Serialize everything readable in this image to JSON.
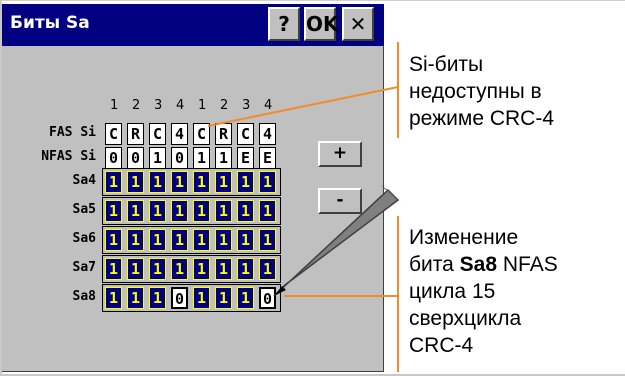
{
  "window": {
    "title": "Биты Sa",
    "help_label": "?",
    "ok_label": "OK",
    "close_label": "✕"
  },
  "column_numbers": [
    "1",
    "2",
    "3",
    "4",
    "1",
    "2",
    "3",
    "4"
  ],
  "rows": [
    {
      "label": "FAS Si",
      "style": "white",
      "values": [
        "C",
        "R",
        "C",
        "4",
        "C",
        "R",
        "C",
        "4"
      ]
    },
    {
      "label": "NFAS Si",
      "style": "white",
      "values": [
        "0",
        "0",
        "1",
        "0",
        "1",
        "1",
        "E",
        "E"
      ]
    },
    {
      "label": "Sa4",
      "style": "blue",
      "values": [
        "1",
        "1",
        "1",
        "1",
        "1",
        "1",
        "1",
        "1"
      ]
    },
    {
      "label": "Sa5",
      "style": "blue",
      "values": [
        "1",
        "1",
        "1",
        "1",
        "1",
        "1",
        "1",
        "1"
      ]
    },
    {
      "label": "Sa6",
      "style": "blue",
      "values": [
        "1",
        "1",
        "1",
        "1",
        "1",
        "1",
        "1",
        "1"
      ]
    },
    {
      "label": "Sa7",
      "style": "blue",
      "values": [
        "1",
        "1",
        "1",
        "1",
        "1",
        "1",
        "1",
        "1"
      ]
    },
    {
      "label": "Sa8",
      "style": "blue",
      "values": [
        "1",
        "1",
        "1",
        "0",
        "1",
        "1",
        "1",
        "0"
      ]
    }
  ],
  "buttons": {
    "plus_label": "+",
    "minus_label": "-"
  },
  "annotations": {
    "si_note": [
      "Si-биты",
      "недоступны в",
      "режиме CRC-4"
    ],
    "sa8_note_pre": "бита ",
    "sa8_note_bold": "Sa8",
    "sa8_note_post": " NFAS",
    "sa8_note_first": "Изменение",
    "sa8_note_rest": [
      "цикла 15",
      "сверхцикла",
      "CRC-4"
    ]
  },
  "colors": {
    "titlebar": "#000080",
    "cell_blue": "#000080",
    "cell_text": "#ffff00",
    "callout": "#f28c28",
    "dialog": "#c0c0c0"
  }
}
